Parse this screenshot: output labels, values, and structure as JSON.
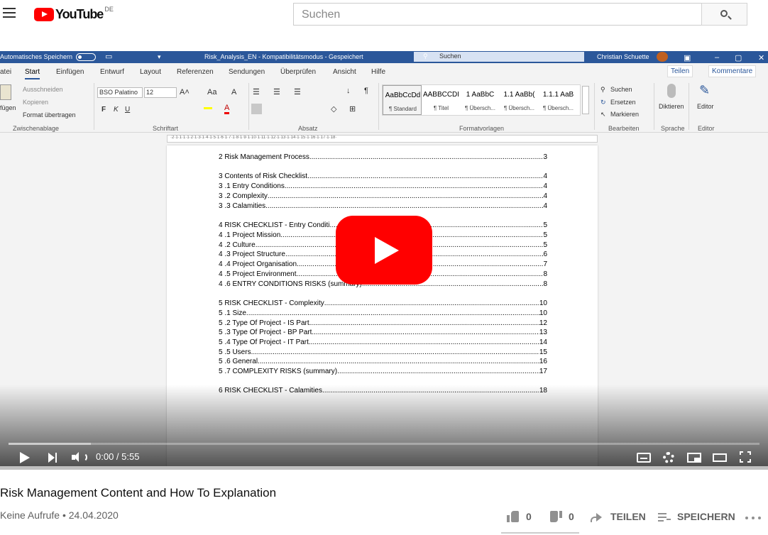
{
  "youtube": {
    "logo_text": "YouTube",
    "country": "DE",
    "search_placeholder": "Suchen"
  },
  "word": {
    "autosave_label": "Automatisches Speichern",
    "doc_title": "Risk_Analysis_EN  -  Kompatibilitätsmodus  -  Gespeichert",
    "search_label": "Suchen",
    "user_name": "Christian Schuette",
    "tabs": [
      "atei",
      "Start",
      "Einfügen",
      "Entwurf",
      "Layout",
      "Referenzen",
      "Sendungen",
      "Überprüfen",
      "Ansicht",
      "Hilfe"
    ],
    "share_label": "Teilen",
    "comments_label": "Kommentare",
    "clipboard": {
      "paste": "fügen",
      "cut": "Ausschneiden",
      "copy": "Kopieren",
      "format_painter": "Format übertragen",
      "group": "Zwischenablage"
    },
    "font": {
      "name": "BSO Palatino",
      "size": "12",
      "group": "Schriftart",
      "bold": "F",
      "italic": "K",
      "underline": "U"
    },
    "paragraph_group": "Absatz",
    "styles": [
      {
        "preview": "AaBbCcDd",
        "name": "¶ Standard"
      },
      {
        "preview": "AABBCCDI",
        "name": "¶ Titel"
      },
      {
        "preview": "1  AaBbC",
        "name": "¶ Übersch..."
      },
      {
        "preview": "1.1  AaBb(",
        "name": "¶ Übersch..."
      },
      {
        "preview": "1.1.1  AaB",
        "name": "¶ Übersch..."
      }
    ],
    "styles_group": "Formatvorlagen",
    "editing": {
      "find": "Suchen",
      "replace": "Ersetzen",
      "select": "Markieren",
      "group": "Bearbeiten"
    },
    "voice": {
      "dictate": "Diktieren",
      "group": "Sprache"
    },
    "editor": {
      "label": "Editor",
      "group": "Editor"
    },
    "ruler_text": "·2·1·1·1·1·2·1·3·1·4·1·5·1·6·1·7·1·8·1·9·1·10·1·11·1·12·1·13·1·14·1·15·1·16·1·17·1·18·"
  },
  "toc": [
    {
      "title": "2 Risk Management Process",
      "page": "3"
    },
    {
      "title": "3 Contents of Risk Checklist",
      "page": "4"
    },
    {
      "title": "3 .1 Entry Conditions",
      "page": "4"
    },
    {
      "title": "3 .2 Complexity",
      "page": "4"
    },
    {
      "title": "3 .3 Calamities",
      "page": "4"
    },
    {
      "title": "4 RISK CHECKLIST  -  Entry Conditi",
      "page": "5"
    },
    {
      "title": "4 .1 Project Mission",
      "page": "5"
    },
    {
      "title": "4 .2 Culture",
      "page": "5"
    },
    {
      "title": "4 .3 Project Structure",
      "page": "6"
    },
    {
      "title": "4 .4 Project Organisation",
      "page": "7"
    },
    {
      "title": "4 .5 Project Environment",
      "page": "8"
    },
    {
      "title": "4 .6 ENTRY CONDITIONS RISKS (summary)",
      "page": "8"
    },
    {
      "title": "5 RISK CHECKLIST  -  Complexity",
      "page": "10"
    },
    {
      "title": "5 .1 Size",
      "page": "10"
    },
    {
      "title": "5 .2 Type Of Project  -  IS Part",
      "page": "12"
    },
    {
      "title": "5 .3 Type Of Project  -  BP Part",
      "page": "13"
    },
    {
      "title": "5 .4 Type Of Project -  IT Part",
      "page": "14"
    },
    {
      "title": "5 .5 Users",
      "page": "15"
    },
    {
      "title": "5 .6 General",
      "page": "16"
    },
    {
      "title": "5 .7 COMPLEXITY RISKS (summary)",
      "page": "17"
    },
    {
      "title": "6 RISK CHECKLIST  -  Calamities",
      "page": "18"
    }
  ],
  "player": {
    "time": "0:00 / 5:55",
    "progress_loaded": 0.11
  },
  "video": {
    "title": "Risk Management Content and How To Explanation",
    "views": "Keine Aufrufe",
    "date": "24.04.2020",
    "likes": "0",
    "dislikes": "0",
    "share": "TEILEN",
    "save": "SPEICHERN"
  }
}
